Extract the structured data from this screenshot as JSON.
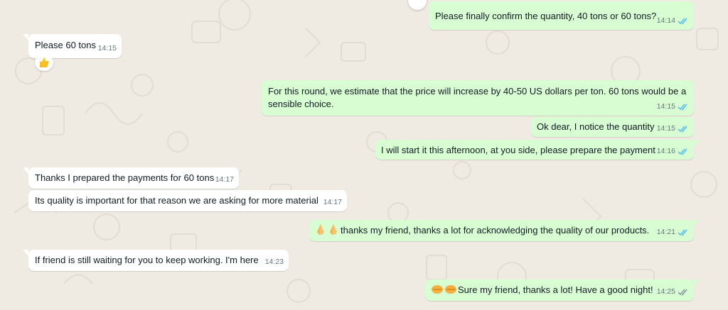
{
  "colors": {
    "background": "#efeae2",
    "incoming_bubble": "#ffffff",
    "outgoing_bubble": "#d9fdd3",
    "read_ticks": "#53bdeb",
    "delivered_ticks": "#8696a0"
  },
  "messages": [
    {
      "text": "Please finally confirm the quantity, 40 tons or 60 tons?",
      "time": "14:14",
      "status": "read"
    },
    {
      "text": "Please  60 tons",
      "time": "14:15",
      "reaction": "thumbs-up"
    },
    {
      "line1": "For this round, we estimate that the price will increase by 40-50 US dollars per ton. 60 tons would be a",
      "line2": "sensible choice.",
      "time": "14:15",
      "status": "read"
    },
    {
      "text": "Ok dear, I notice the quantity",
      "time": "14:15",
      "status": "read"
    },
    {
      "text": "I will start it this afternoon, at you side, please prepare the payment",
      "time": "14:16",
      "status": "read"
    },
    {
      "text": "Thanks I prepared the payments for 60 tons",
      "time": "14:17"
    },
    {
      "text": "Its quality is important for that reason we are asking for more material",
      "time": "14:17"
    },
    {
      "text": "thanks my friend, thanks a lot for acknowledging the quality of our products.",
      "time": "14:21",
      "status": "read",
      "emoji": "folded-hands"
    },
    {
      "text": "If friend is still waiting for you to keep working. I'm here",
      "time": "14:23"
    },
    {
      "text": "Sure my friend, thanks a lot!  Have a good night!",
      "time": "14:25",
      "status": "delivered",
      "emoji": "handshake"
    }
  ]
}
